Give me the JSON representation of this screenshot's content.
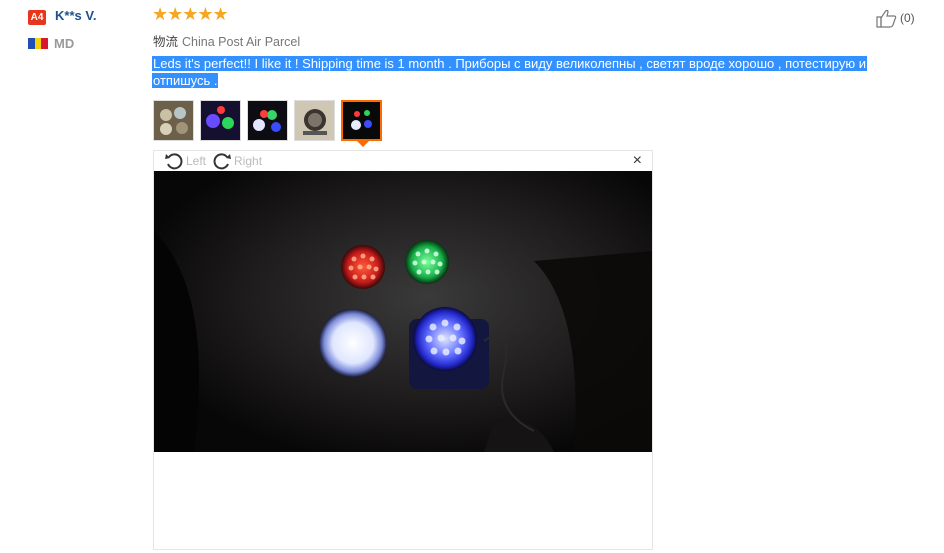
{
  "reviewer": {
    "badge": "A4",
    "name": "K**s V.",
    "country_code": "MD",
    "flag_colors": [
      "#1f4fb5",
      "#f5d20b",
      "#d8182c"
    ]
  },
  "rating": {
    "stars": 5,
    "glyphs": "★★★★★",
    "color": "#f5a623"
  },
  "helpful": {
    "icon": "thumbs-up-icon",
    "count_label": "(0)"
  },
  "shipping": {
    "label": "物流",
    "value": "China Post Air Parcel"
  },
  "review": {
    "text_line1": "Leds it's perfect!! I like it ! Shipping time is 1 month . Приборы с виду великолепны , светят вроде хорошо , потестирую и",
    "text_line2": "отпишусь ."
  },
  "photos": {
    "count": 5,
    "active_index": 4,
    "accent": "#ff6a00"
  },
  "viewer": {
    "rotate_left_label": "Left",
    "rotate_right_label": "Right",
    "close_glyph": "×"
  }
}
